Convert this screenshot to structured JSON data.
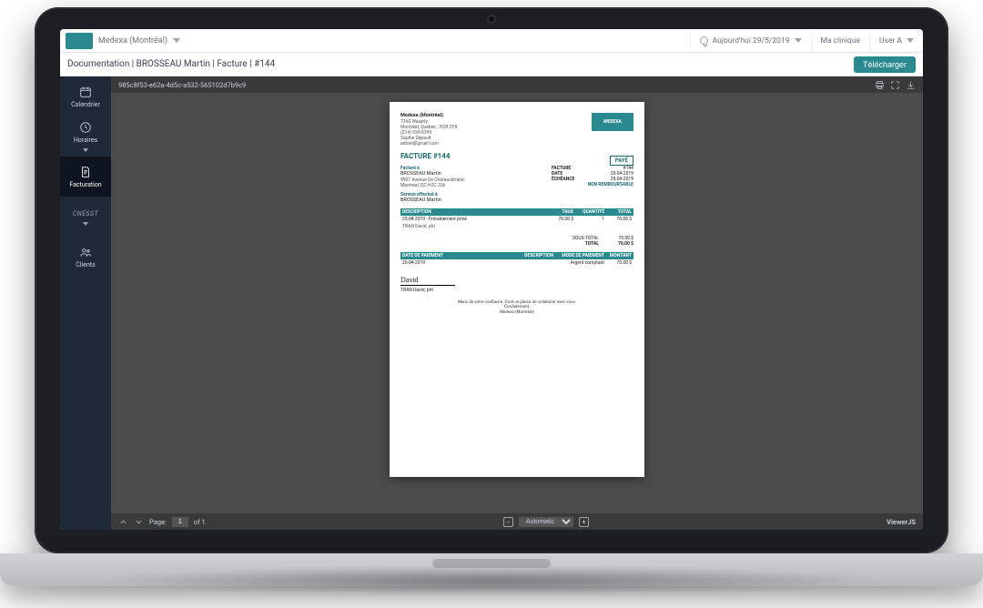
{
  "topbar": {
    "clinic": "Medexa (Montréal)",
    "date_button": "Aujourd'hui 29/5/2019",
    "my_clinic": "Ma clinique",
    "user": "User A"
  },
  "subheader": {
    "breadcrumb": "Documentation | BROSSEAU Martin | Facture | #144",
    "download": "Télécharger"
  },
  "sidebar": {
    "calendar": "Calendrier",
    "schedules": "Horaires",
    "billing": "Facturation",
    "cnesst": "CNESST",
    "clients": "Clients"
  },
  "viewer": {
    "doc_id": "985c8f53-e62a-4d5c-a532-565102d7b9c9",
    "prev": "↑",
    "next": "↓",
    "page_label": "Page:",
    "page": "1",
    "pages_of": "of 1",
    "zoom_label": "Automatic",
    "brand": "ViewerJS"
  },
  "invoice": {
    "company": "Medexa (Montréal)",
    "addr1": "7260 Waverly",
    "addr2": "Montréal, Québec - H2R 2Y8",
    "phone": "(514) 939-9399",
    "contact": "Sophie Dépault",
    "email": "admin@gmail.com",
    "logo": "MEDEXA",
    "title": "FACTURE #144",
    "stamp": "PAYÉ",
    "bill_to_label": "Facturé à",
    "bill_to_name": "BROSSEAU Martin",
    "bill_to_addr1": "9907 Avenue De Châteaubriand",
    "bill_to_addr2": "Montréal, QC H2C 2S6",
    "service_to_label": "Service effectué à",
    "service_to_name": "BROSSEAU Martin",
    "meta": [
      {
        "k": "FACTURE",
        "v": "#144"
      },
      {
        "k": "DATE",
        "v": "25-04-2019"
      },
      {
        "k": "ÉCHÉANCE",
        "v": "25-04-2019"
      }
    ],
    "non_refundable": "NON REMBOURSABLE",
    "columns": {
      "desc": "DESCRIPTION",
      "rate": "TAUX",
      "qty": "QUANTITÉ",
      "total": "TOTAL"
    },
    "lines": [
      {
        "desc": "25-04-2019 - Entraînement privé",
        "rate": "70.00 $",
        "qty": "1",
        "total": "70.00 $"
      }
    ],
    "line_sub": "TRAN David, pht",
    "subtotal_label": "SOUS-TOTAL",
    "subtotal": "70.00 $",
    "total_label": "TOTAL",
    "total": "70.00 $",
    "pay_columns": {
      "date": "DATE DE PAIEMENT",
      "desc": "DESCRIPTION",
      "mode": "MODE DE PAIEMENT",
      "amount": "MONTANT"
    },
    "payments": [
      {
        "date": "25-04-2019",
        "desc": "",
        "mode": "Argent comptant",
        "amount": "70.00 $"
      }
    ],
    "sig_name": "TRAN David, pht",
    "thanks": "Merci de votre confiance. C'est un plaisir de collaborer avec vous.",
    "cordial": "Cordialement,",
    "company_foot": "Medexa (Montréal)"
  }
}
